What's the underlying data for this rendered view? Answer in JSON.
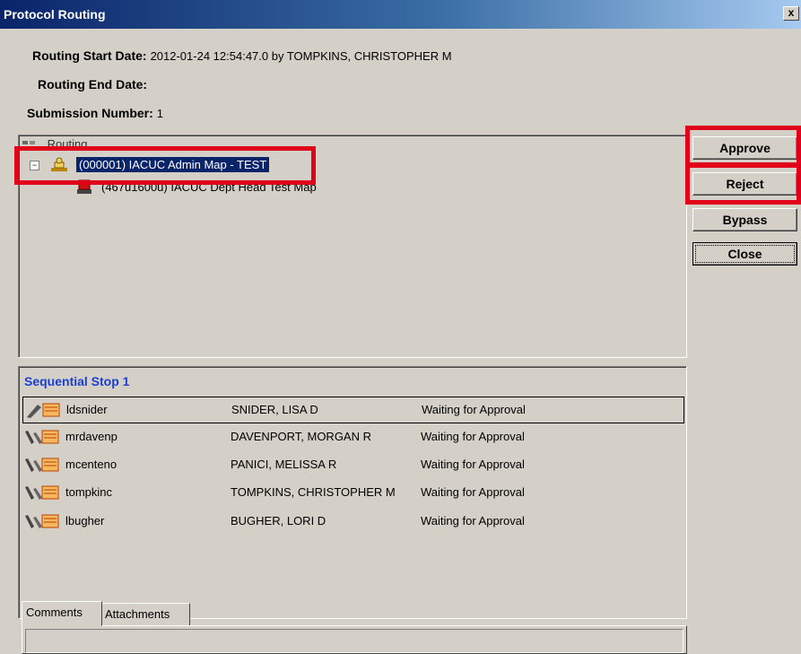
{
  "window": {
    "title": "Protocol Routing",
    "close_label": "x"
  },
  "info": {
    "start_label": "Routing Start Date:",
    "start_value": "2012-01-24 12:54:47.0 by TOMPKINS, CHRISTOPHER M",
    "end_label": "Routing End Date:",
    "end_value": "",
    "submission_label": "Submission Number:",
    "submission_value": "1"
  },
  "tree": {
    "root_label": "Routing",
    "expander": "−",
    "nodes": [
      {
        "label": "(000001) IACUC Admin Map - TEST",
        "selected": true
      },
      {
        "label": "(467u1600u) IACUC Dept Head Test Map",
        "selected": false
      }
    ]
  },
  "buttons": {
    "approve": "Approve",
    "reject": "Reject",
    "bypass": "Bypass",
    "close": "Close"
  },
  "stop": {
    "title": "Sequential Stop 1",
    "rows": [
      {
        "uid": "ldsnider",
        "name": "SNIDER, LISA D",
        "status": "Waiting for Approval"
      },
      {
        "uid": "mrdavenp",
        "name": "DAVENPORT, MORGAN R",
        "status": "Waiting for Approval"
      },
      {
        "uid": "mcenteno",
        "name": "PANICI, MELISSA R",
        "status": "Waiting for Approval"
      },
      {
        "uid": "tompkinc",
        "name": "TOMPKINS, CHRISTOPHER M",
        "status": "Waiting for Approval"
      },
      {
        "uid": "lbugher",
        "name": "BUGHER, LORI D",
        "status": "Waiting for Approval"
      }
    ]
  },
  "tabs": {
    "comments": "Comments",
    "attachments": "Attachments"
  },
  "colors": {
    "highlight": "#e0001a",
    "selection": "#0a246a",
    "stop_title": "#1a3fd0"
  }
}
